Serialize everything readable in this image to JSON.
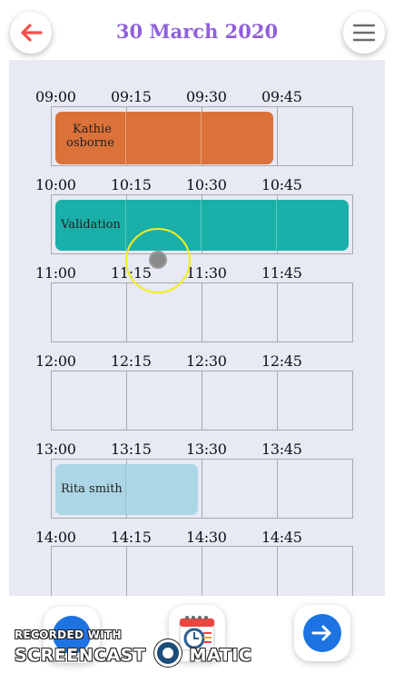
{
  "header": {
    "title": "30 March 2020",
    "title_color": "#9060d8",
    "back_icon": "arrow-left-icon",
    "back_icon_color": "#f0514f",
    "menu_icon": "hamburger-menu-icon"
  },
  "schedule": {
    "hours": [
      {
        "labels": [
          "09:00",
          "09:15",
          "09:30",
          "09:45"
        ]
      },
      {
        "labels": [
          "10:00",
          "10:15",
          "10:30",
          "10:45"
        ]
      },
      {
        "labels": [
          "11:00",
          "11:15",
          "11:30",
          "11:45"
        ]
      },
      {
        "labels": [
          "12:00",
          "12:15",
          "12:30",
          "12:45"
        ]
      },
      {
        "labels": [
          "13:00",
          "13:15",
          "13:30",
          "13:45"
        ]
      },
      {
        "labels": [
          "14:00",
          "14:15",
          "14:30",
          "14:45"
        ]
      }
    ],
    "events": [
      {
        "line1": "Kathie",
        "line2": "osborne",
        "color": "#db723a"
      },
      {
        "line1": "Validation",
        "color": "#1aafa8"
      },
      {
        "line1": "Rita smith",
        "color": "#acd6e6"
      }
    ]
  },
  "footer": {
    "left_icon": "circle-button-icon",
    "center_icon": "calendar-icon",
    "right_icon": "arrow-right-icon",
    "accent": "#1d73e2"
  },
  "watermark": {
    "line1": "RECORDED WITH",
    "line2_left": "SCREENCAST",
    "line2_right": "MATIC"
  }
}
